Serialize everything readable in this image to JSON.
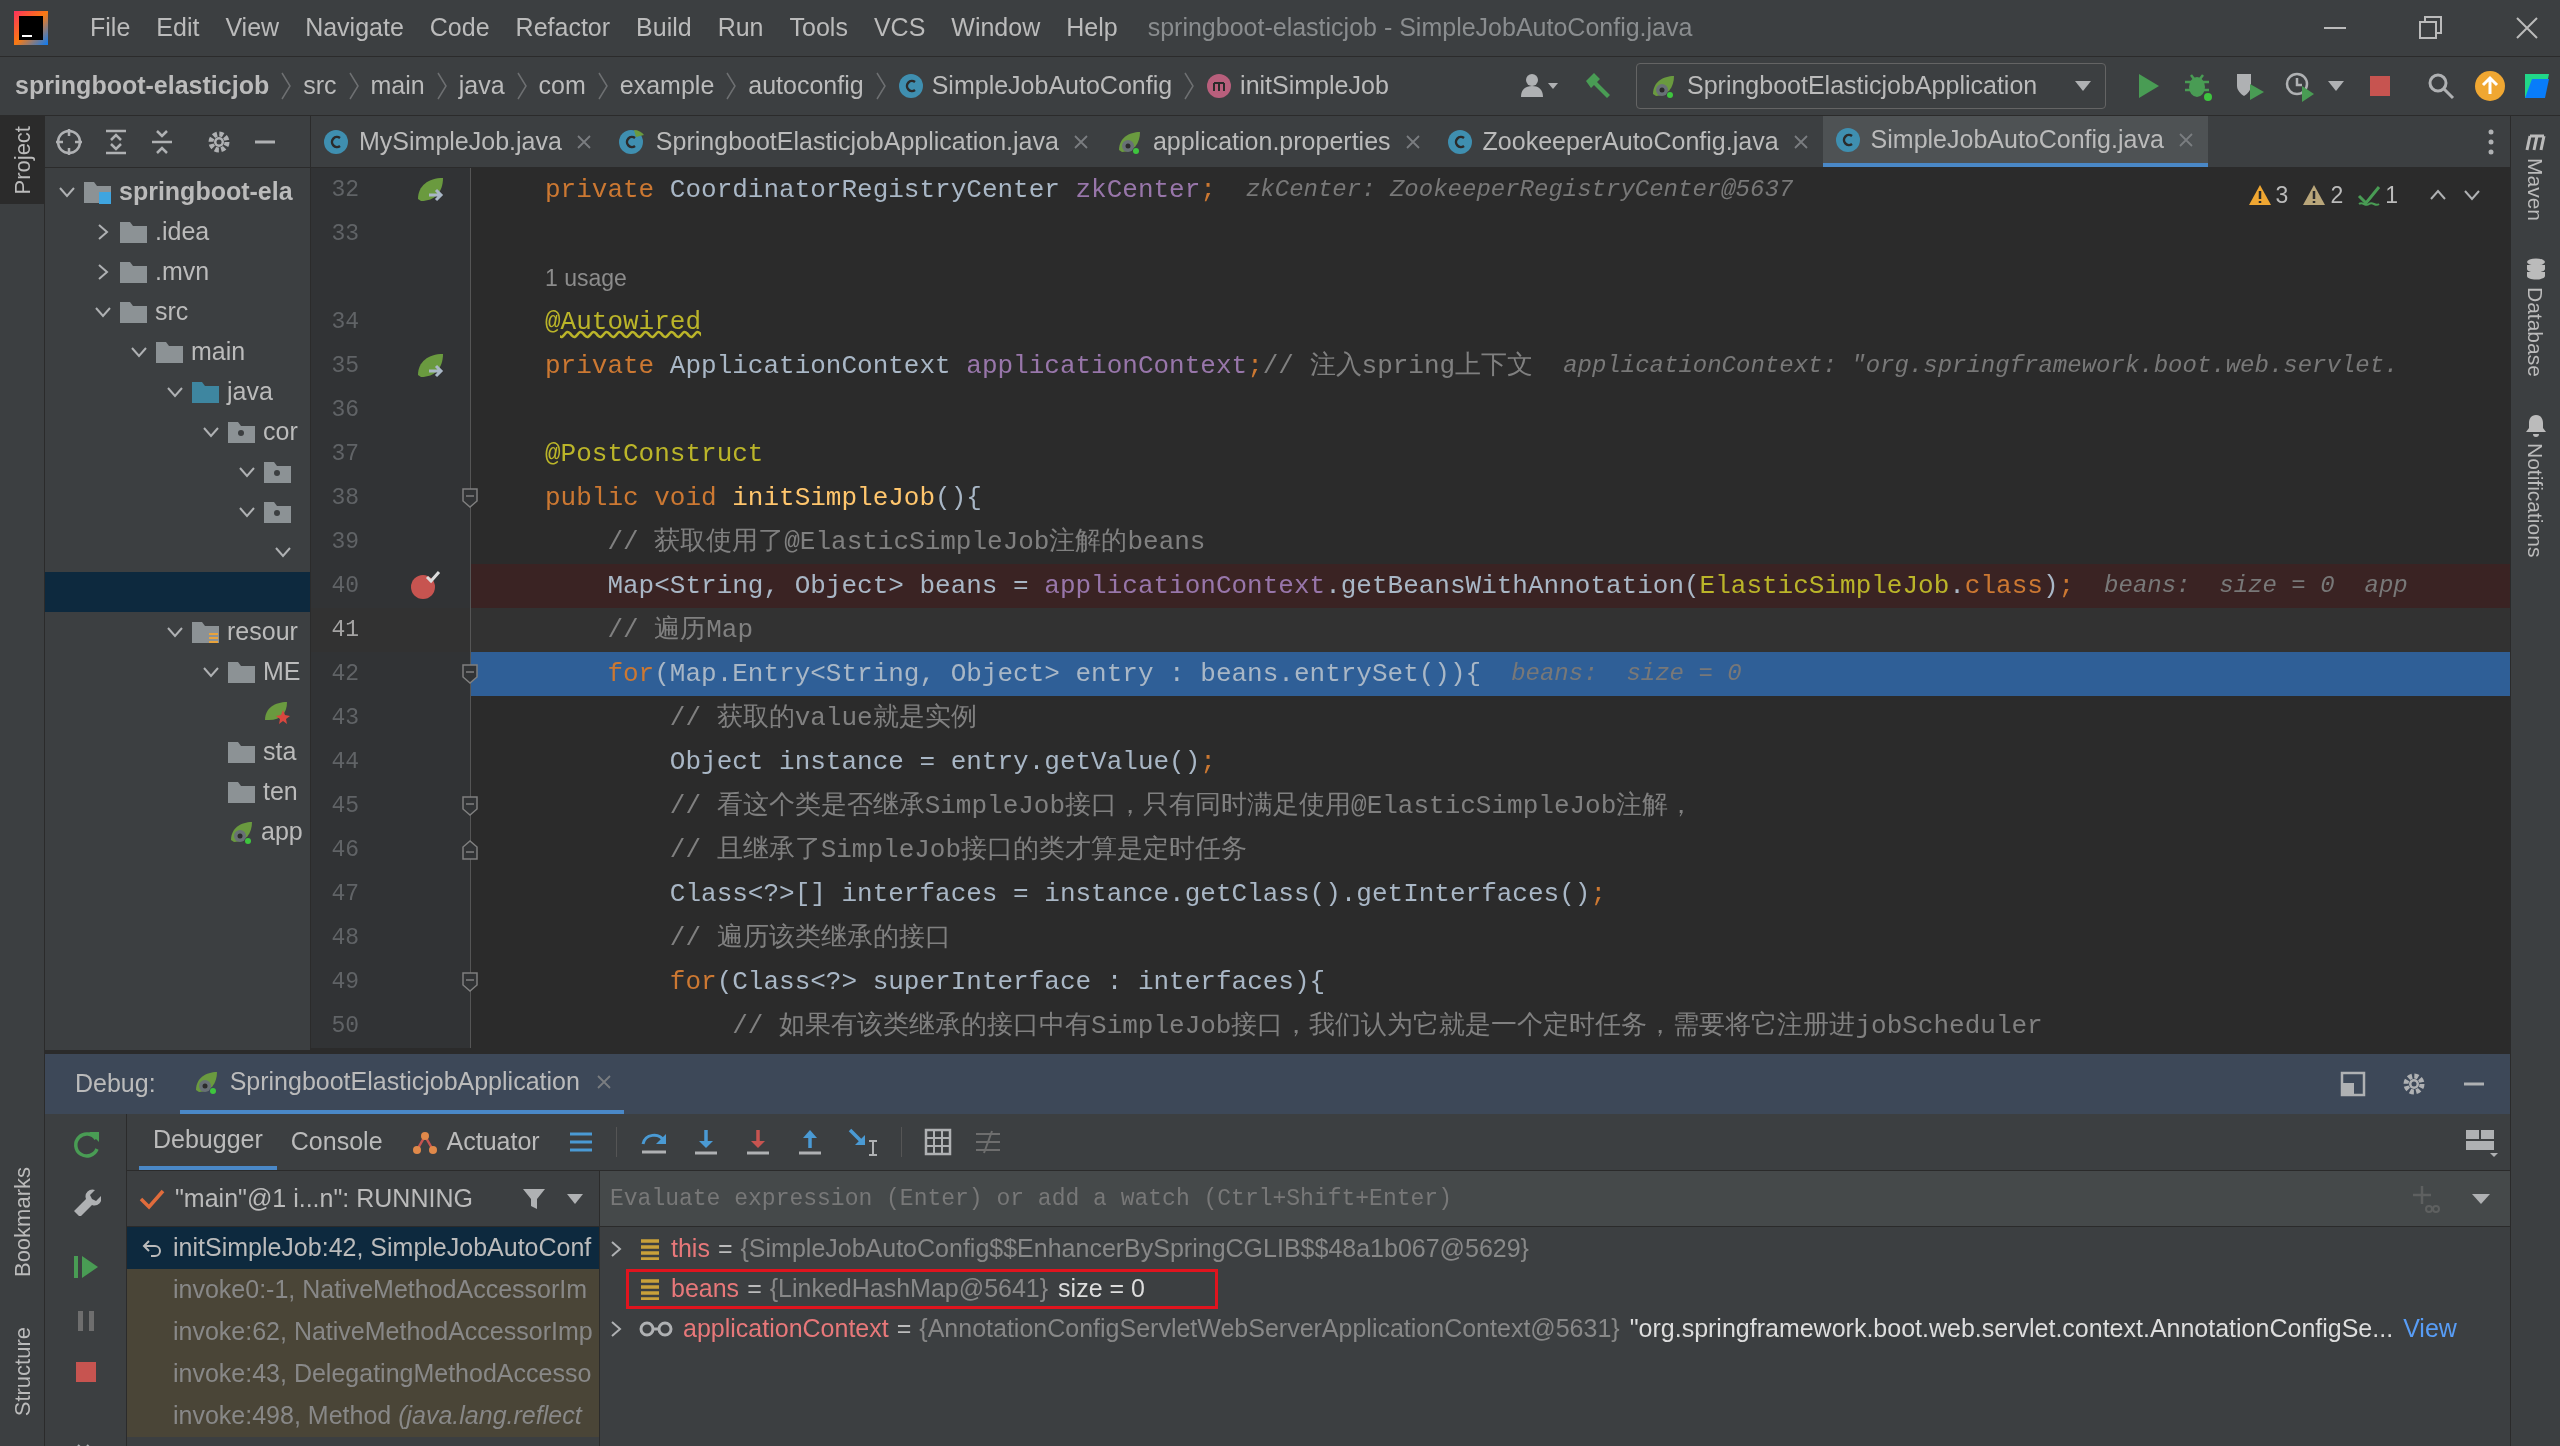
{
  "window": {
    "title": "springboot-elasticjob - SimpleJobAutoConfig.java"
  },
  "menu": [
    "File",
    "Edit",
    "View",
    "Navigate",
    "Code",
    "Refactor",
    "Build",
    "Run",
    "Tools",
    "VCS",
    "Window",
    "Help"
  ],
  "breadcrumbs": [
    {
      "kind": "project",
      "label": "springboot-elasticjob"
    },
    {
      "kind": "folder",
      "label": "src"
    },
    {
      "kind": "folder",
      "label": "main"
    },
    {
      "kind": "folder",
      "label": "java"
    },
    {
      "kind": "folder",
      "label": "com"
    },
    {
      "kind": "folder",
      "label": "example"
    },
    {
      "kind": "folder",
      "label": "autoconfig"
    },
    {
      "kind": "class",
      "label": "SimpleJobAutoConfig"
    },
    {
      "kind": "method",
      "label": "initSimpleJob"
    }
  ],
  "run_configuration": {
    "label": "SpringbootElasticjobApplication"
  },
  "left_tool_windows_top": [
    {
      "label": "Project",
      "selected": true
    }
  ],
  "left_tool_windows_bottom": [
    {
      "label": "Bookmarks",
      "selected": false
    },
    {
      "label": "Structure",
      "selected": false
    }
  ],
  "right_tool_windows": [
    {
      "kind": "maven",
      "label": "Maven"
    },
    {
      "kind": "database",
      "label": "Database"
    },
    {
      "kind": "notifications",
      "label": "Notifications"
    }
  ],
  "editor_tabs": [
    {
      "kind": "class",
      "label": "MySimpleJob.java",
      "selected": false
    },
    {
      "kind": "spring_class",
      "label": "SpringbootElasticjobApplication.java",
      "selected": false
    },
    {
      "kind": "properties",
      "label": "application.properties",
      "selected": false
    },
    {
      "kind": "class",
      "label": "ZookeeperAutoConfig.java",
      "selected": false
    },
    {
      "kind": "class",
      "label": "SimpleJobAutoConfig.java",
      "selected": true
    }
  ],
  "inspections": [
    {
      "kind": "warning",
      "count": "3"
    },
    {
      "kind": "weak_warning",
      "count": "2"
    },
    {
      "kind": "typo",
      "count": "1"
    }
  ],
  "project_tree": [
    {
      "kind": "module",
      "label": "springboot-ela",
      "expanded": true,
      "selected": false,
      "children": [
        {
          "kind": "folder",
          "label": ".idea",
          "expanded": false,
          "selected": false
        },
        {
          "kind": "folder",
          "label": ".mvn",
          "expanded": false,
          "selected": false
        },
        {
          "kind": "folder",
          "label": "src",
          "expanded": true,
          "selected": false,
          "children": [
            {
              "kind": "folder",
              "label": "main",
              "expanded": true,
              "selected": false,
              "children": [
                {
                  "kind": "source_root",
                  "label": "java",
                  "expanded": true,
                  "selected": false,
                  "children": [
                    {
                      "kind": "package",
                      "label": "cor",
                      "expanded": true,
                      "selected": false,
                      "children": [
                        {
                          "kind": "package",
                          "expanded": true,
                          "selected": false
                        },
                        {
                          "kind": "package",
                          "expanded": true,
                          "selected": false,
                          "children": [
                            {
                              "expanded": true,
                              "selected": false
                            },
                            {
                              "selected": true
                            }
                          ]
                        }
                      ]
                    }
                  ]
                },
                {
                  "kind": "resources_root",
                  "label": "resour",
                  "expanded": true,
                  "selected": false,
                  "children": [
                    {
                      "kind": "folder",
                      "label": "ME",
                      "expanded": true,
                      "selected": false,
                      "children": [
                        {
                          "kind": "spring_factories",
                          "selected": false
                        }
                      ]
                    },
                    {
                      "kind": "folder",
                      "label": "sta",
                      "selected": false
                    },
                    {
                      "kind": "folder",
                      "label": "ten",
                      "selected": false
                    },
                    {
                      "kind": "properties",
                      "label": "app",
                      "selected": false
                    }
                  ]
                }
              ]
            }
          ]
        }
      ]
    }
  ],
  "editor": {
    "lines": [
      {
        "kind": "code",
        "number": "32",
        "breakpoint": false,
        "execution": false,
        "caret": false,
        "bean_marker": true,
        "segments": [
          {
            "kind": "keyword",
            "text": "private "
          },
          {
            "kind": "plain",
            "text": "CoordinatorRegistryCenter "
          },
          {
            "kind": "field",
            "text": "zkCenter"
          },
          {
            "kind": "keyword",
            "text": ";"
          }
        ],
        "hints": [
          "zkCenter: ZookeeperRegistryCenter@5637"
        ]
      },
      {
        "kind": "code",
        "number": "33",
        "breakpoint": false,
        "execution": false,
        "caret": false
      },
      {
        "kind": "usage",
        "text": "1 usage"
      },
      {
        "kind": "code",
        "number": "34",
        "breakpoint": false,
        "execution": false,
        "caret": false,
        "segments": [
          {
            "kind": "annotation_warning",
            "text": "@Autowired"
          }
        ]
      },
      {
        "kind": "code",
        "number": "35",
        "breakpoint": false,
        "execution": false,
        "caret": false,
        "bean_marker": true,
        "segments": [
          {
            "kind": "keyword",
            "text": "private "
          },
          {
            "kind": "plain",
            "text": "ApplicationContext "
          },
          {
            "kind": "field",
            "text": "applicationContext"
          },
          {
            "kind": "keyword",
            "text": ";"
          },
          {
            "kind": "comment",
            "text": "// 注入spring上下文"
          }
        ],
        "hints": [
          "applicationContext: \"org.springframework.boot.web.servlet."
        ]
      },
      {
        "kind": "code",
        "number": "36",
        "breakpoint": false,
        "execution": false,
        "caret": false
      },
      {
        "kind": "code",
        "number": "37",
        "breakpoint": false,
        "execution": false,
        "caret": false,
        "segments": [
          {
            "kind": "annotation",
            "text": "@PostConstruct"
          }
        ]
      },
      {
        "kind": "code",
        "number": "38",
        "breakpoint": false,
        "execution": false,
        "caret": false,
        "fold_start": true,
        "segments": [
          {
            "kind": "keyword",
            "text": "public void "
          },
          {
            "kind": "method",
            "text": "initSimpleJob"
          },
          {
            "kind": "plain",
            "text": "(){"
          }
        ]
      },
      {
        "kind": "code",
        "number": "39",
        "breakpoint": false,
        "execution": false,
        "caret": false,
        "segments": [
          {
            "kind": "comment",
            "text": "    // 获取使用了@ElasticSimpleJob注解的beans"
          }
        ]
      },
      {
        "kind": "code",
        "number": "40",
        "breakpoint": true,
        "execution": false,
        "caret": false,
        "segments": [
          {
            "kind": "plain",
            "text": "    Map<String, Object> beans = "
          },
          {
            "kind": "field",
            "text": "applicationContext"
          },
          {
            "kind": "plain",
            "text": ".getBeansWithAnnotation("
          },
          {
            "kind": "annotation",
            "text": "ElasticSimpleJob"
          },
          {
            "kind": "plain",
            "text": "."
          },
          {
            "kind": "keyword",
            "text": "class"
          },
          {
            "kind": "plain",
            "text": ")"
          },
          {
            "kind": "keyword",
            "text": ";"
          }
        ],
        "hints": [
          "beans:  size = 0",
          "app"
        ]
      },
      {
        "kind": "code",
        "number": "41",
        "breakpoint": false,
        "execution": false,
        "caret": true,
        "segments": [
          {
            "kind": "comment",
            "text": "    // 遍历Map"
          }
        ]
      },
      {
        "kind": "code",
        "number": "42",
        "breakpoint": false,
        "execution": true,
        "caret": false,
        "fold_start": true,
        "segments": [
          {
            "kind": "keyword",
            "text": "    for"
          },
          {
            "kind": "plain",
            "text": "(Map.Entry<String, Object> entry : beans.entrySet()){"
          }
        ],
        "hints": [
          "beans:  size = 0"
        ]
      },
      {
        "kind": "code",
        "number": "43",
        "breakpoint": false,
        "execution": false,
        "caret": false,
        "segments": [
          {
            "kind": "comment",
            "text": "        // 获取的value就是实例"
          }
        ]
      },
      {
        "kind": "code",
        "number": "44",
        "breakpoint": false,
        "execution": false,
        "caret": false,
        "segments": [
          {
            "kind": "plain",
            "text": "        Object instance = entry.getValue()"
          },
          {
            "kind": "keyword",
            "text": ";"
          }
        ]
      },
      {
        "kind": "code",
        "number": "45",
        "breakpoint": false,
        "execution": false,
        "caret": false,
        "fold_start": true,
        "segments": [
          {
            "kind": "comment",
            "text": "        // 看这个类是否继承SimpleJob接口，只有同时满足使用@ElasticSimpleJob注解，"
          }
        ]
      },
      {
        "kind": "code",
        "number": "46",
        "breakpoint": false,
        "execution": false,
        "caret": false,
        "fold_end": true,
        "segments": [
          {
            "kind": "comment",
            "text": "        // 且继承了SimpleJob接口的类才算是定时任务"
          }
        ]
      },
      {
        "kind": "code",
        "number": "47",
        "breakpoint": false,
        "execution": false,
        "caret": false,
        "segments": [
          {
            "kind": "plain",
            "text": "        Class<?>[] interfaces = instance.getClass().getInterfaces()"
          },
          {
            "kind": "keyword",
            "text": ";"
          }
        ]
      },
      {
        "kind": "code",
        "number": "48",
        "breakpoint": false,
        "execution": false,
        "caret": false,
        "segments": [
          {
            "kind": "comment",
            "text": "        // 遍历该类继承的接口"
          }
        ]
      },
      {
        "kind": "code",
        "number": "49",
        "breakpoint": false,
        "execution": false,
        "caret": false,
        "fold_start": true,
        "segments": [
          {
            "kind": "keyword",
            "text": "        for"
          },
          {
            "kind": "plain",
            "text": "(Class<?> superInterface : interfaces){"
          }
        ]
      },
      {
        "kind": "code",
        "number": "50",
        "breakpoint": false,
        "execution": false,
        "caret": false,
        "segments": [
          {
            "kind": "comment",
            "text": "            // 如果有该类继承的接口中有SimpleJob接口，我们认为它就是一个定时任务，需要将它注册进jobScheduler"
          }
        ]
      }
    ]
  },
  "debug": {
    "title": "Debug:",
    "session_tab": {
      "label": "SpringbootElasticjobApplication",
      "selected": true
    },
    "tabs": [
      {
        "kind": "debugger",
        "label": "Debugger",
        "selected": true
      },
      {
        "kind": "console",
        "label": "Console",
        "selected": false
      },
      {
        "kind": "actuator",
        "label": "Actuator",
        "selected": false
      }
    ],
    "thread": {
      "label": "\"main\"@1 i...n\": RUNNING"
    },
    "frames": [
      {
        "label": "initSimpleJob:42, SimpleJobAutoConf",
        "selected": true,
        "library": false
      },
      {
        "label": "invoke0:-1, NativeMethodAccessorIm",
        "selected": false,
        "library": true
      },
      {
        "label": "invoke:62, NativeMethodAccessorImp",
        "selected": false,
        "library": true
      },
      {
        "label": "invoke:43, DelegatingMethodAccesso",
        "selected": false,
        "library": true
      },
      {
        "label": "invoke:498, Method *(java.lang.reflect*",
        "selected": false,
        "library": true
      }
    ],
    "evaluate": {
      "placeholder": "Evaluate expression (Enter) or add a watch (Ctrl+Shift+Enter)"
    },
    "variables": [
      {
        "kind": "field",
        "name": "this",
        "operator": "=",
        "value": "{SimpleJobAutoConfig$$EnhancerBySpringCGLIB$$48a1b067@5629}",
        "expandable": true,
        "highlighted": false
      },
      {
        "kind": "field",
        "name": "beans",
        "operator": "=",
        "value": "{LinkedHashMap@5641}",
        "extra": "size = 0",
        "expandable": false,
        "highlighted": true
      },
      {
        "kind": "watch",
        "name": "applicationContext",
        "operator": "=",
        "value": "{AnnotationConfigServletWebServerApplicationContext@5631}",
        "extra": "\"org.springframework.boot.web.servlet.context.AnnotationConfigSe...",
        "link": "View",
        "expandable": true,
        "highlighted": false
      }
    ]
  }
}
